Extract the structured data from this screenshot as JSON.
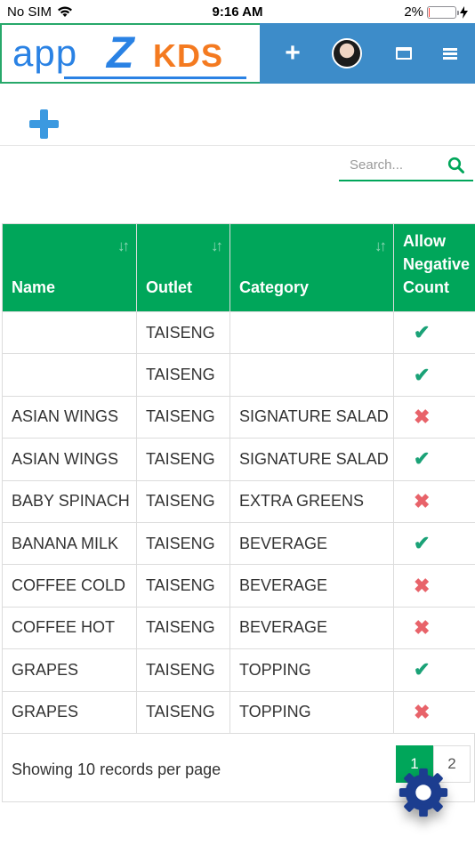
{
  "status_bar": {
    "carrier": "No SIM",
    "time": "9:16 AM",
    "battery": "2%"
  },
  "header": {
    "logo": {
      "app": "app",
      "z": "Z",
      "kds": "KDS"
    },
    "add_label": "+"
  },
  "search": {
    "placeholder": "Search..."
  },
  "table": {
    "columns": [
      "Name",
      "Outlet",
      "Category",
      "Allow Negative Count"
    ],
    "rows": [
      {
        "name": "",
        "outlet": "TAISENG",
        "category": "",
        "allow_negative": true
      },
      {
        "name": "",
        "outlet": "TAISENG",
        "category": "",
        "allow_negative": true
      },
      {
        "name": "ASIAN WINGS",
        "outlet": "TAISENG",
        "category": "SIGNATURE SALAD",
        "allow_negative": false
      },
      {
        "name": "ASIAN WINGS",
        "outlet": "TAISENG",
        "category": "SIGNATURE SALAD",
        "allow_negative": true
      },
      {
        "name": "BABY SPINACH",
        "outlet": "TAISENG",
        "category": "EXTRA GREENS",
        "allow_negative": false
      },
      {
        "name": "BANANA MILK",
        "outlet": "TAISENG",
        "category": "BEVERAGE",
        "allow_negative": true
      },
      {
        "name": "COFFEE COLD",
        "outlet": "TAISENG",
        "category": "BEVERAGE",
        "allow_negative": false
      },
      {
        "name": "COFFEE HOT",
        "outlet": "TAISENG",
        "category": "BEVERAGE",
        "allow_negative": false
      },
      {
        "name": "GRAPES",
        "outlet": "TAISENG",
        "category": "TOPPING",
        "allow_negative": true
      },
      {
        "name": "GRAPES",
        "outlet": "TAISENG",
        "category": "TOPPING",
        "allow_negative": false
      }
    ]
  },
  "footer": {
    "showing": "Showing 10 records per page",
    "pages": [
      "1",
      "2"
    ],
    "active_page": "1"
  },
  "colors": {
    "brand_green": "#00a65a",
    "nav_blue": "#3d8cc9",
    "check": "#1aa277",
    "cross": "#e8636a",
    "gear": "#1c3d8f"
  },
  "icons": {
    "check": "check-icon",
    "cross": "cross-icon",
    "settings": "gear-icon"
  }
}
